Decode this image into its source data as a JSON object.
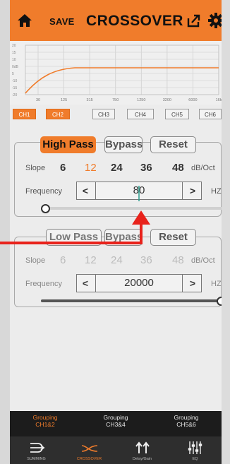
{
  "header": {
    "save_label": "SAVE",
    "title": "CROSSOVER",
    "accent_color": "#f07c2b"
  },
  "graph": {
    "y_ticks": [
      "20",
      "15",
      "10",
      "0dB",
      "5",
      "-10",
      "-15",
      "-20"
    ],
    "x_ticks": [
      "30",
      "125",
      "315",
      "750",
      "1250",
      "3200",
      "6000",
      "16k"
    ],
    "curve_color": "#f07c2b"
  },
  "channels": [
    {
      "label": "CH1",
      "active": true
    },
    {
      "label": "CH2",
      "active": true
    },
    {
      "label": "CH3",
      "active": false
    },
    {
      "label": "CH4",
      "active": false
    },
    {
      "label": "CH5",
      "active": false
    },
    {
      "label": "CH6",
      "active": false
    }
  ],
  "high_pass": {
    "mode_label": "High Pass",
    "bypass_label": "Bypass",
    "reset_label": "Reset",
    "slope_label": "Slope",
    "slopes": [
      "6",
      "12",
      "24",
      "36",
      "48"
    ],
    "selected_slope": "12",
    "slope_unit": "dB/Oct",
    "frequency_label": "Frequency",
    "frequency_value": "80",
    "frequency_unit": "HZ",
    "prev_label": "<",
    "next_label": ">",
    "slider_level": 0.0
  },
  "low_pass": {
    "mode_label": "Low Pass",
    "bypass_label": "Bypass",
    "reset_label": "Reset",
    "slope_label": "Slope",
    "slopes": [
      "6",
      "12",
      "24",
      "36",
      "48"
    ],
    "slope_unit": "dB/Oct",
    "frequency_label": "Frequency",
    "frequency_value": "20000",
    "frequency_unit": "HZ",
    "prev_label": "<",
    "next_label": ">",
    "slider_level": 1.0
  },
  "grouping": [
    {
      "line1": "Grouping",
      "line2": "CH1&2",
      "active": true
    },
    {
      "line1": "Grouping",
      "line2": "CH3&4",
      "active": false
    },
    {
      "line1": "Grouping",
      "line2": "CH5&6",
      "active": false
    }
  ],
  "nav": [
    {
      "label": "SUMMING",
      "icon": "summing-icon",
      "active": false
    },
    {
      "label": "CROSSOVER",
      "icon": "crossover-icon",
      "active": true
    },
    {
      "label": "Delay/Gain",
      "icon": "delay-gain-icon",
      "active": false
    },
    {
      "label": "EQ",
      "icon": "eq-icon",
      "active": false
    }
  ]
}
